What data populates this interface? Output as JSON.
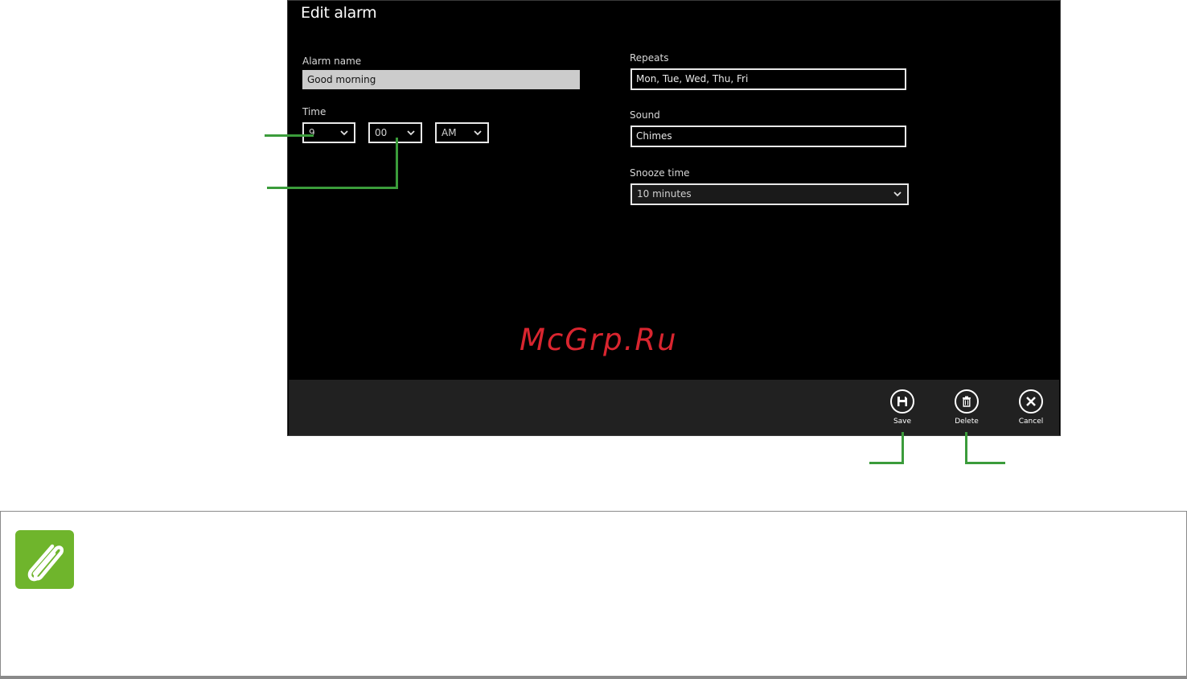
{
  "screen": {
    "title": "Edit alarm",
    "alarm_name": {
      "label": "Alarm name",
      "value": "Good morning"
    },
    "time": {
      "label": "Time",
      "hour": "9",
      "minute": "00",
      "period": "AM"
    },
    "repeats": {
      "label": "Repeats",
      "value": "Mon, Tue, Wed, Thu, Fri"
    },
    "sound": {
      "label": "Sound",
      "value": "Chimes"
    },
    "snooze": {
      "label": "Snooze time",
      "value": "10 minutes"
    },
    "app_bar": {
      "save_label": "Save",
      "delete_label": "Delete",
      "cancel_label": "Cancel"
    }
  },
  "watermark": "McGrp.Ru",
  "colors": {
    "screen_bg": "#000000",
    "app_bar_bg": "#212121",
    "callout": "#3b9c3b",
    "note_icon": "#6fb52c",
    "watermark": "#d9252f"
  },
  "icons": {
    "save": "floppy-disk-icon",
    "delete": "trash-icon",
    "cancel": "close-icon",
    "note": "paperclip-icon"
  }
}
